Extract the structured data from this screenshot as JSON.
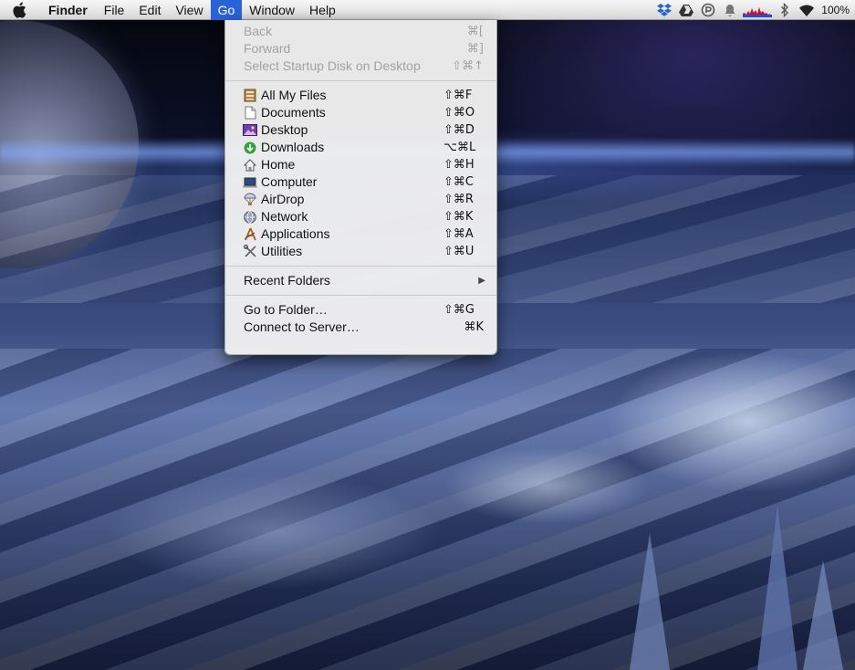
{
  "menubar": {
    "apple_icon": "apple-logo-icon",
    "app_name": "Finder",
    "menus": [
      "File",
      "Edit",
      "View",
      "Go",
      "Window",
      "Help"
    ],
    "active_menu": "Go",
    "status_icons": [
      "dropbox-icon",
      "google-drive-icon",
      "sync-icon",
      "notification-bell-icon",
      "activity-graph-icon",
      "bluetooth-icon",
      "wifi-icon"
    ],
    "battery": "100%"
  },
  "go_menu": {
    "section1": [
      {
        "label": "Back",
        "shortcut": "⌘[",
        "enabled": false
      },
      {
        "label": "Forward",
        "shortcut": "⌘]",
        "enabled": false
      },
      {
        "label": "Select Startup Disk on Desktop",
        "shortcut": "⇧⌘↑",
        "enabled": false
      }
    ],
    "section2": [
      {
        "label": "All My Files",
        "shortcut": "⇧⌘F",
        "icon": "all-my-files-icon"
      },
      {
        "label": "Documents",
        "shortcut": "⇧⌘O",
        "icon": "documents-icon"
      },
      {
        "label": "Desktop",
        "shortcut": "⇧⌘D",
        "icon": "desktop-icon"
      },
      {
        "label": "Downloads",
        "shortcut": "⌥⌘L",
        "icon": "downloads-icon"
      },
      {
        "label": "Home",
        "shortcut": "⇧⌘H",
        "icon": "home-icon"
      },
      {
        "label": "Computer",
        "shortcut": "⇧⌘C",
        "icon": "computer-icon"
      },
      {
        "label": "AirDrop",
        "shortcut": "⇧⌘R",
        "icon": "airdrop-icon"
      },
      {
        "label": "Network",
        "shortcut": "⇧⌘K",
        "icon": "network-icon"
      },
      {
        "label": "Applications",
        "shortcut": "⇧⌘A",
        "icon": "applications-icon"
      },
      {
        "label": "Utilities",
        "shortcut": "⇧⌘U",
        "icon": "utilities-icon"
      }
    ],
    "section3": [
      {
        "label": "Recent Folders",
        "submenu": true
      }
    ],
    "section4": [
      {
        "label": "Go to Folder…",
        "shortcut": "⇧⌘G"
      },
      {
        "label": "Connect to Server…",
        "shortcut": "⌘K"
      }
    ]
  },
  "colors": {
    "menu_highlight": "#2a62d8",
    "disabled_text": "#a2a2a2"
  }
}
